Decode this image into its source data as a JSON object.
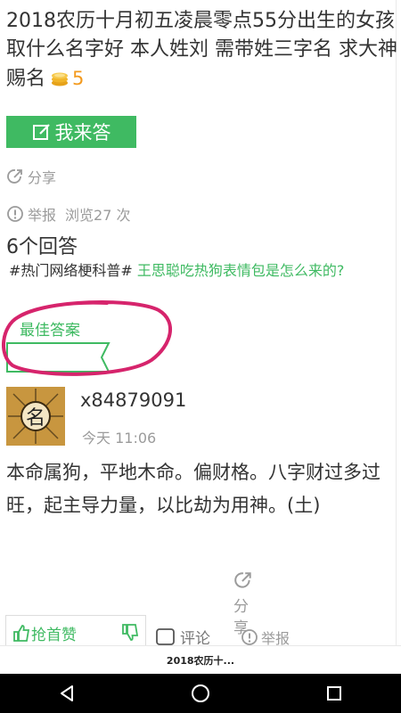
{
  "question": {
    "title": "2018农历十月初五凌晨零点55分出生的女孩取什么名字好 本人姓刘 需带姓三字名 求大神赐名",
    "reward": "5",
    "coin_icon": "coins-icon"
  },
  "answer_button": {
    "label": "我来答",
    "icon": "edit-icon"
  },
  "share": {
    "label": "分享",
    "icon": "share-icon"
  },
  "report": {
    "label": "举报",
    "icon": "warning-icon"
  },
  "views": "浏览27 次",
  "answers_count": "6个回答",
  "hot_topic": {
    "tag": "#热门网络梗科普#",
    "link": " 王思聪吃热狗表情包是怎么来的?"
  },
  "best_answer": {
    "label": "最佳答案"
  },
  "answer": {
    "avatar_char": "名",
    "username": "x84879091",
    "time": "今天 11:06",
    "body": "本命属狗，平地木命。偏财格。八字财过多过旺，起主导力量，以比劫为用神。(土)"
  },
  "actions": {
    "like_label": "抢首赞",
    "comment_label": "评论",
    "share_label": "分享",
    "report_label": "举报"
  },
  "bottom_tab": {
    "label": "2018农历十..."
  },
  "colors": {
    "accent": "#3fba62",
    "reward": "#f39a1e",
    "circle": "#d6246c"
  }
}
